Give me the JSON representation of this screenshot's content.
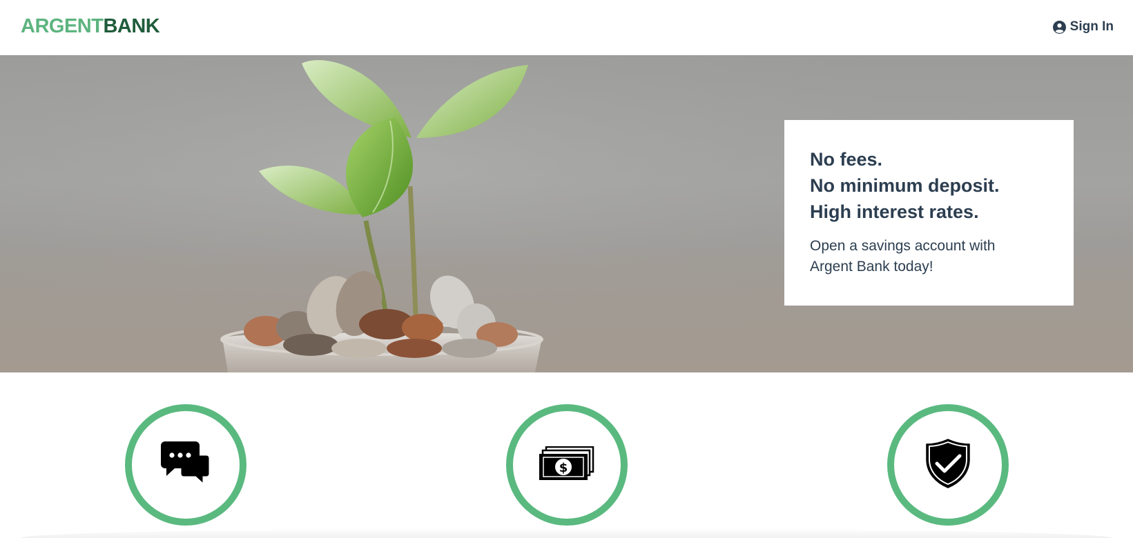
{
  "nav": {
    "logo_part_a": "ARGENT",
    "logo_part_b": "BANK",
    "signin_label": "Sign In",
    "signin_icon": "user-circle-icon"
  },
  "hero": {
    "headline_lines": [
      "No fees.",
      "No minimum deposit.",
      "High interest rates."
    ],
    "lead_lines": [
      "Open a savings account with",
      "Argent Bank today!"
    ],
    "image": "plant-in-coins-jar"
  },
  "features": [
    {
      "icon": "chat-icon"
    },
    {
      "icon": "money-icon"
    },
    {
      "icon": "security-shield-icon"
    }
  ],
  "colors": {
    "brand_light": "#5db47f",
    "brand_dark": "#1f5c3b",
    "feature_ring": "#5ab97f",
    "text": "#2c3e50"
  }
}
